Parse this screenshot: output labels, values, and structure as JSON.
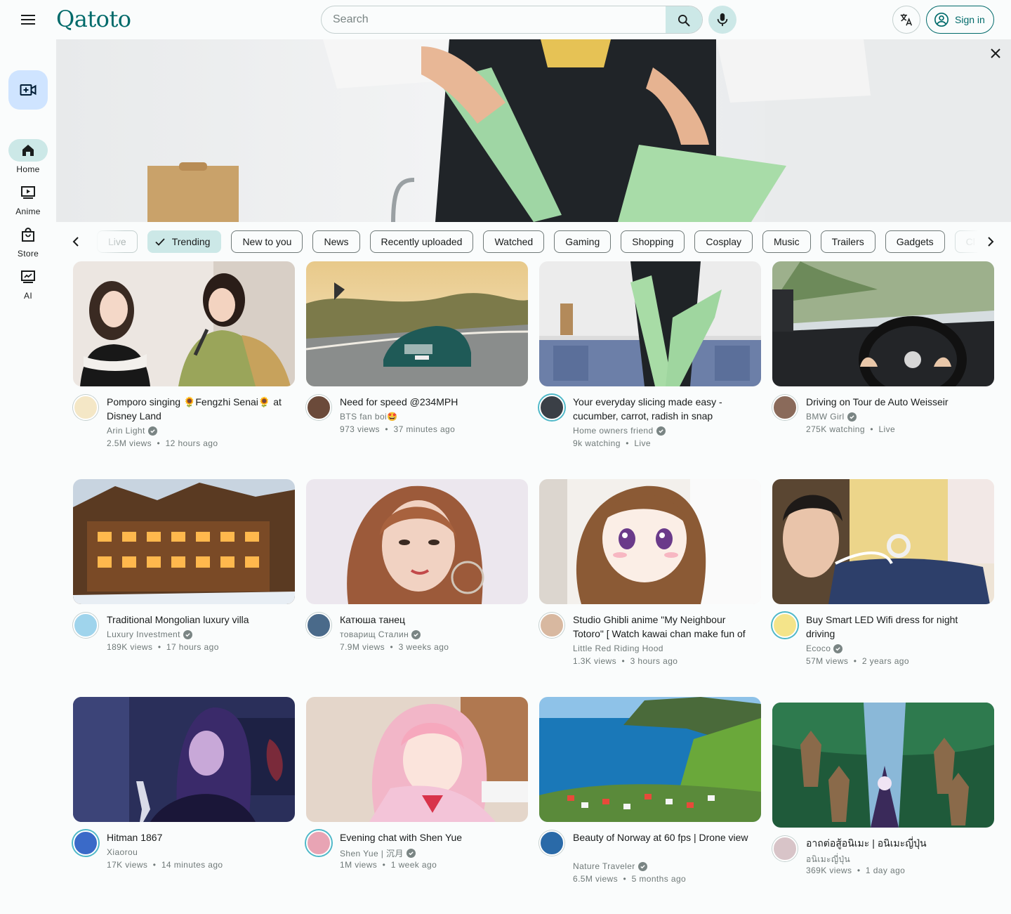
{
  "app": {
    "name": "Qatoto"
  },
  "header": {
    "search_placeholder": "Search",
    "signin_label": "Sign in",
    "icons": [
      "menu-icon",
      "search-icon",
      "mic-icon",
      "translate-icon",
      "account-circle-icon"
    ]
  },
  "rail": {
    "items": [
      {
        "label": "Home",
        "icon": "home-icon"
      },
      {
        "label": "Anime",
        "icon": "play-screen-icon"
      },
      {
        "label": "Store",
        "icon": "shopping-bag-icon"
      },
      {
        "label": "AI",
        "icon": "ai-screen-icon"
      }
    ],
    "active": "Home"
  },
  "chips": [
    {
      "label": "Live"
    },
    {
      "label": "Trending"
    },
    {
      "label": "New to you"
    },
    {
      "label": "News"
    },
    {
      "label": "Recently uploaded"
    },
    {
      "label": "Watched"
    },
    {
      "label": "Gaming"
    },
    {
      "label": "Shopping"
    },
    {
      "label": "Cosplay"
    },
    {
      "label": "Music"
    },
    {
      "label": "Trailers"
    },
    {
      "label": "Gadgets"
    },
    {
      "label": "Cl"
    }
  ],
  "selected_chip": "Trending",
  "videos": [
    {
      "title": "Pomporo singing 🌻Fengzhi Senai🌻 at Disney Land",
      "channel": "Arin Light",
      "verified": true,
      "views": "2.5M views",
      "age": "12 hours ago"
    },
    {
      "title": "Need for speed @234MPH",
      "channel": "BTS fan boi🤩",
      "verified": false,
      "views": "973 views",
      "age": "37 minutes ago"
    },
    {
      "title": "Your everyday slicing made easy - cucumber, carrot, radish in snap",
      "channel": "Home owners friend",
      "verified": true,
      "views": "9k watching",
      "age": "Live"
    },
    {
      "title": "Driving on Tour de Auto Weisseir",
      "channel": "BMW Girl",
      "verified": true,
      "views": "275K watching",
      "age": "Live"
    },
    {
      "title": "Traditional Mongolian luxury villa",
      "channel": "Luxury Investment",
      "verified": true,
      "views": "189K views",
      "age": "17 hours ago"
    },
    {
      "title": "Катюша танец",
      "channel": "товарищ Сталин",
      "verified": true,
      "views": "7.9M views",
      "age": "3 weeks ago"
    },
    {
      "title": "Studio Ghibli anime \"My Neighbour Totoro\" [ Watch kawai chan make fun of Kurosawa's uncle ]",
      "channel": "Little Red Riding Hood",
      "verified": false,
      "views": "1.3K views",
      "age": "3 hours ago"
    },
    {
      "title": "Buy Smart LED Wifi dress for night driving",
      "channel": "Ecoco",
      "verified": true,
      "views": "57M views",
      "age": "2 years ago"
    },
    {
      "title": "Hitman 1867",
      "channel": "Xiaorou",
      "verified": false,
      "views": "17K views",
      "age": "14 minutes ago"
    },
    {
      "title": "Evening chat with Shen Yue",
      "channel": "Shen Yue | 沉月",
      "verified": true,
      "views": "1M views",
      "age": "1 week ago"
    },
    {
      "title": "Beauty of Norway at 60 fps | Drone view",
      "channel": "Nature Traveler",
      "verified": true,
      "views": "6.5M views",
      "age": "5 months ago"
    },
    {
      "title": "อาถต่อสู้อนิเมะ | อนิเมะญี่ปุ่น",
      "channel": "อนิเมะญี่ปุ่น",
      "verified": false,
      "views": "369K views",
      "age": "1 day ago"
    }
  ]
}
